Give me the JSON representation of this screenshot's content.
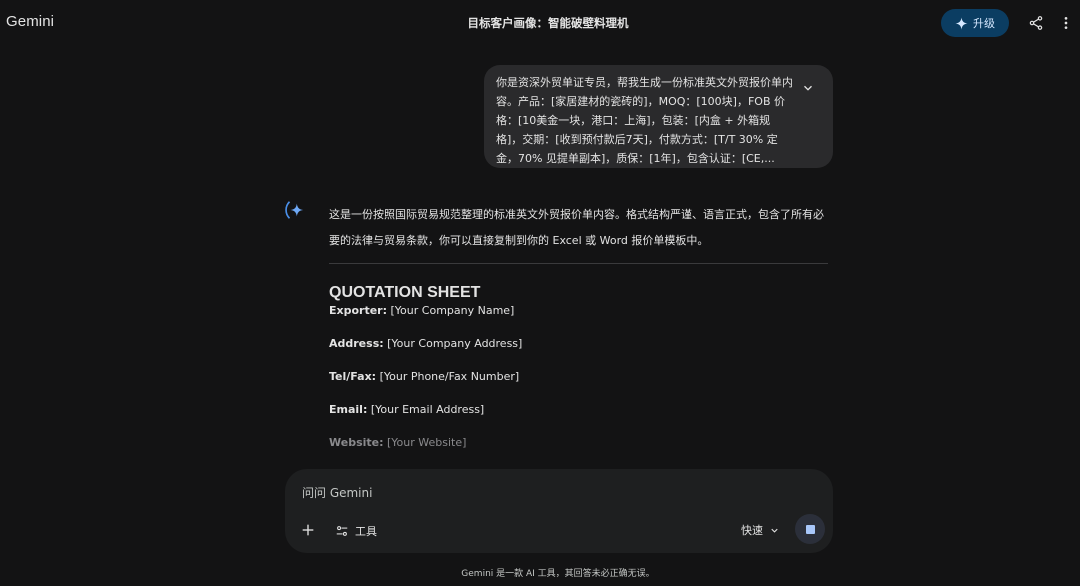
{
  "header": {
    "brand": "Gemini",
    "chat_title": "目标客户画像：智能破壁料理机",
    "upgrade_label": "升级"
  },
  "user_message": {
    "text": "你是资深外贸单证专员，帮我生成一份标准英文外贸报价单内容。产品：[家居建材的瓷砖的]，MOQ：[100块]，FOB 价格：[10美金一块，港口：上海]，包装：[内盒 + 外箱规格]，交期：[收到预付款后7天]，付款方式：[T/T 30% 定金，70% 见提单副本]，质保：[1年]，包含认证：[CE,..."
  },
  "response": {
    "intro": "这是一份按照国际贸易规范整理的标准英文外贸报价单内容。格式结构严谨、语言正式，包含了所有必要的法律与贸易条款，你可以直接复制到你的 Excel 或 Word 报价单模板中。",
    "heading": "QUOTATION SHEET",
    "fields": [
      {
        "label": "Exporter:",
        "value": " [Your Company Name]"
      },
      {
        "label": "Address:",
        "value": " [Your Company Address]"
      },
      {
        "label": "Tel/Fax:",
        "value": " [Your Phone/Fax Number]"
      },
      {
        "label": "Email:",
        "value": " [Your Email Address]"
      },
      {
        "label": "Website:",
        "value": " [Your Website]"
      }
    ]
  },
  "composer": {
    "placeholder": "问问 Gemini",
    "tools_label": "工具",
    "mode_label": "快速"
  },
  "footer": {
    "disclaimer": "Gemini 是一款 AI 工具，其回答未必正确无误。"
  },
  "colors": {
    "background": "#131314",
    "bubble": "#2a2a2c",
    "upgrade": "#0b3d62",
    "accent": "#a8c7fa"
  }
}
